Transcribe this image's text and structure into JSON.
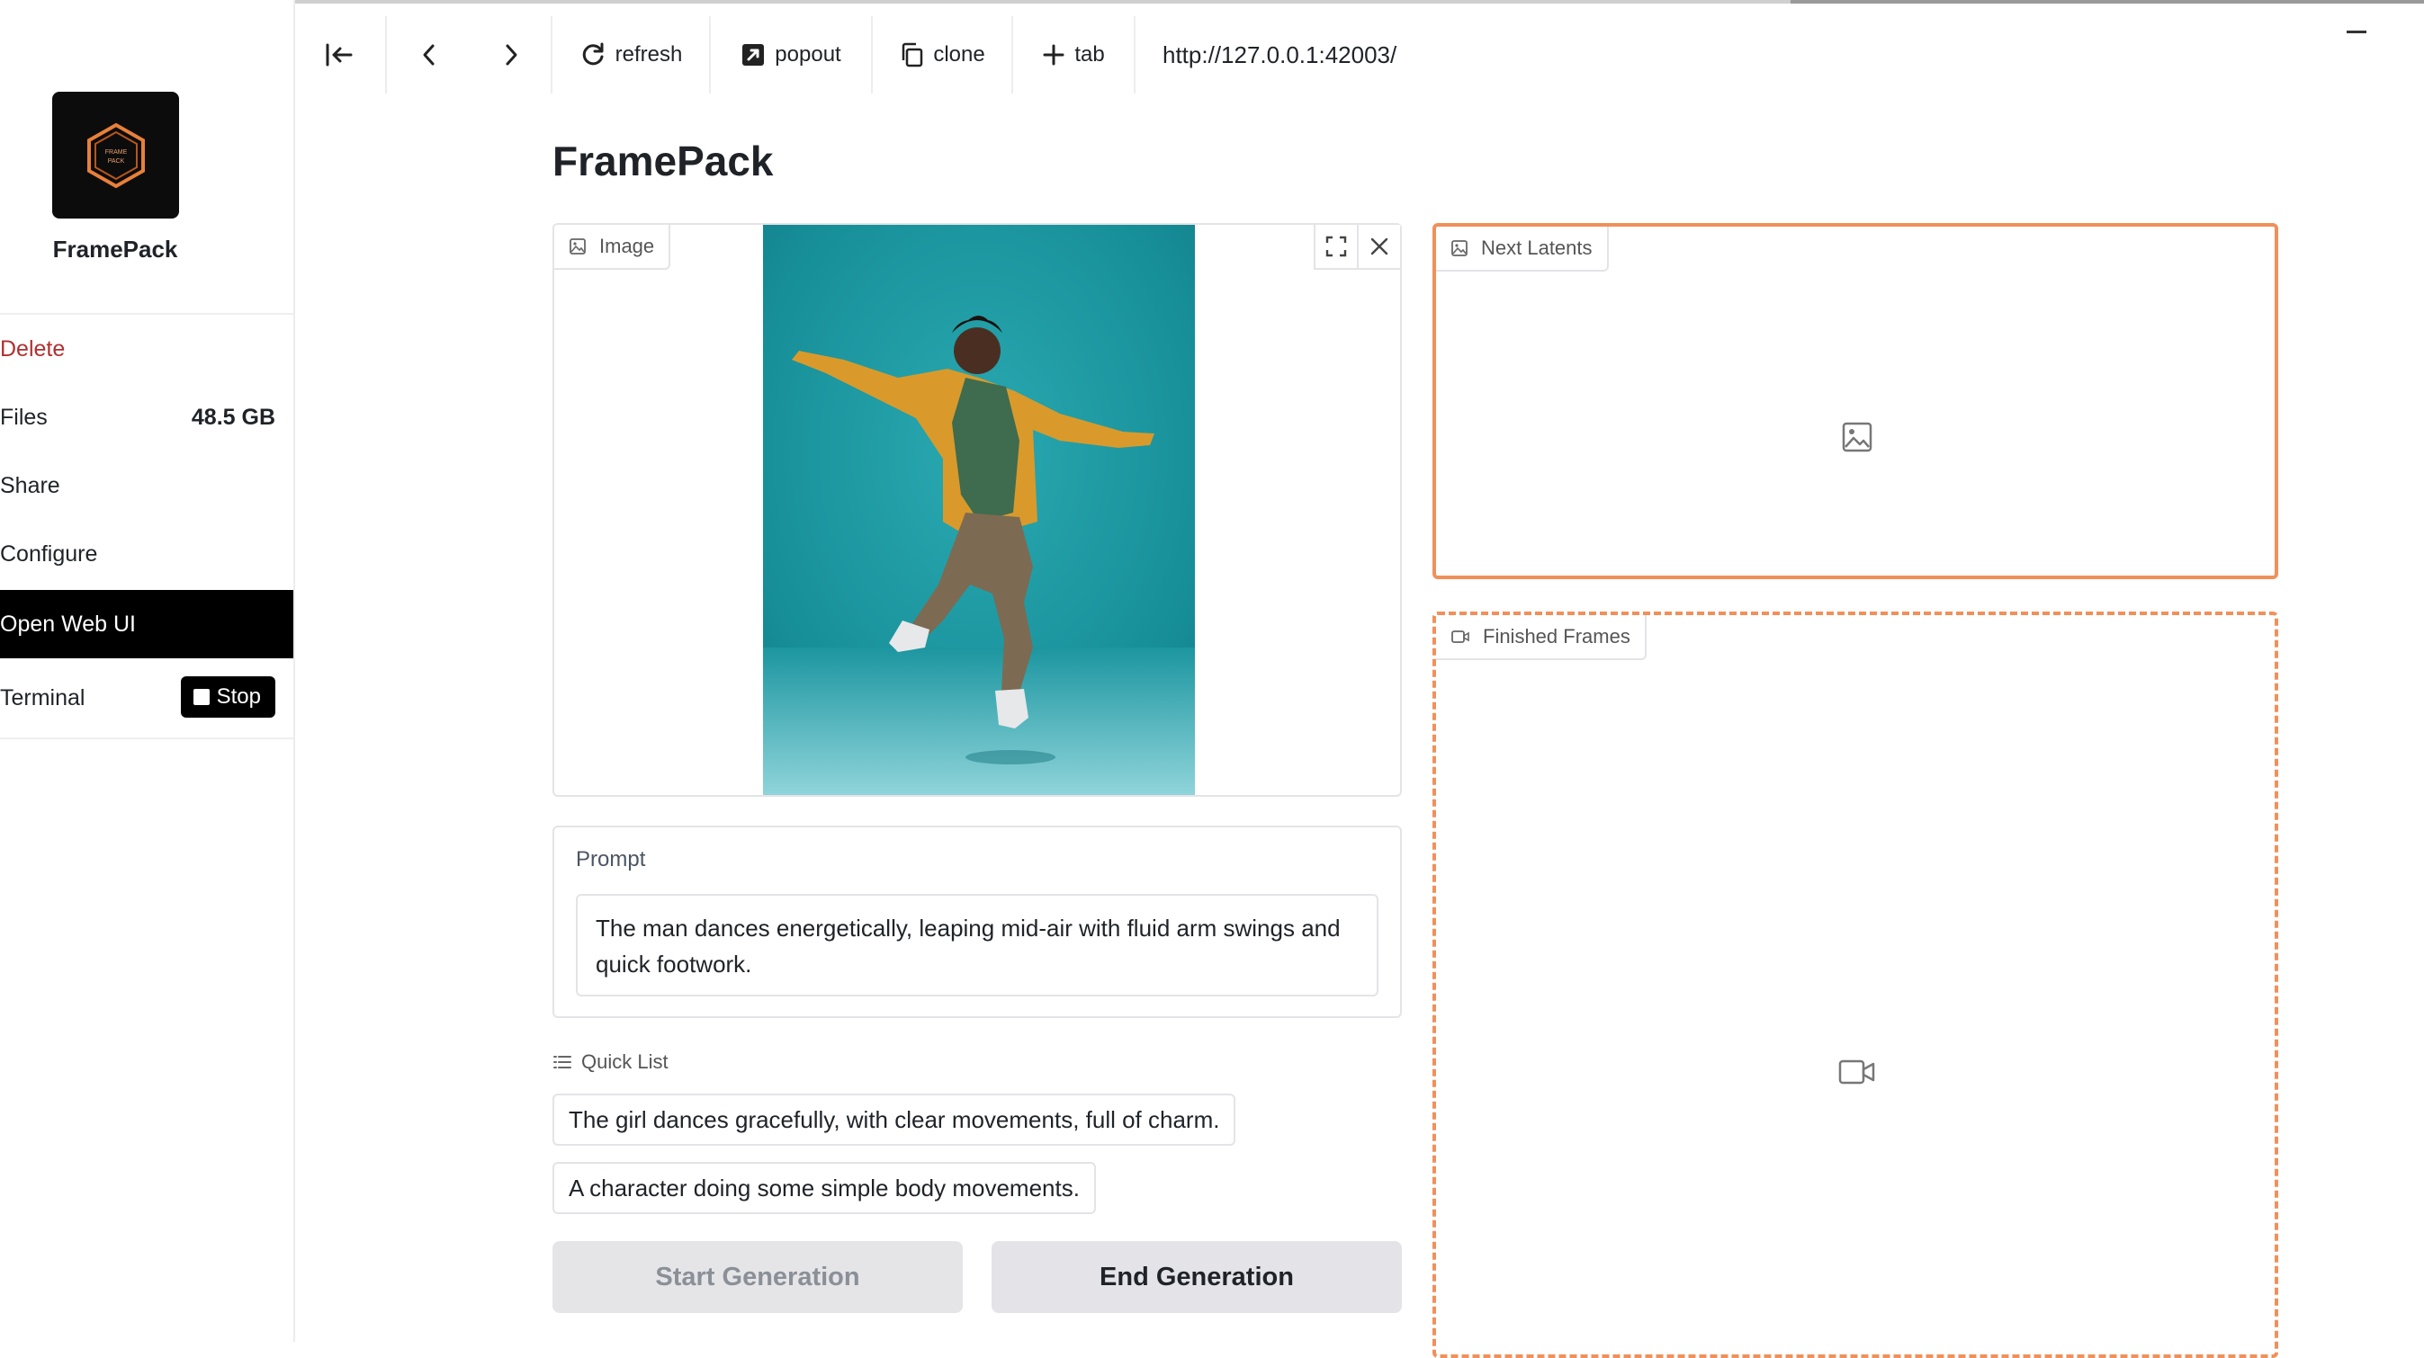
{
  "sidebar": {
    "app_name": "FramePack",
    "logo_text_line1": "FRAME",
    "logo_text_line2": "PACK",
    "items": [
      {
        "label": "Delete"
      },
      {
        "label": "Files",
        "value": "48.5 GB"
      },
      {
        "label": "Share"
      },
      {
        "label": "Configure"
      },
      {
        "label": "Open Web UI"
      },
      {
        "label": "Terminal"
      }
    ],
    "stop_label": "Stop"
  },
  "toolbar": {
    "refresh": "refresh",
    "popout": "popout",
    "clone": "clone",
    "tab": "tab",
    "url": "http://127.0.0.1:42003/"
  },
  "main": {
    "title": "FramePack",
    "image_label": "Image",
    "prompt_label": "Prompt",
    "prompt_value": "The man dances energetically, leaping mid-air with fluid arm swings and quick footwork.",
    "quick_list_label": "Quick List",
    "quick_list": [
      "The girl dances gracefully, with clear movements, full of charm.",
      "A character doing some simple body movements."
    ],
    "start_button": "Start Generation",
    "end_button": "End Generation",
    "next_latents_label": "Next Latents",
    "finished_frames_label": "Finished Frames"
  },
  "colors": {
    "accent_orange": "#f0905a",
    "sidebar_active_bg": "#000000",
    "image_bg": "#1f9aa3"
  }
}
